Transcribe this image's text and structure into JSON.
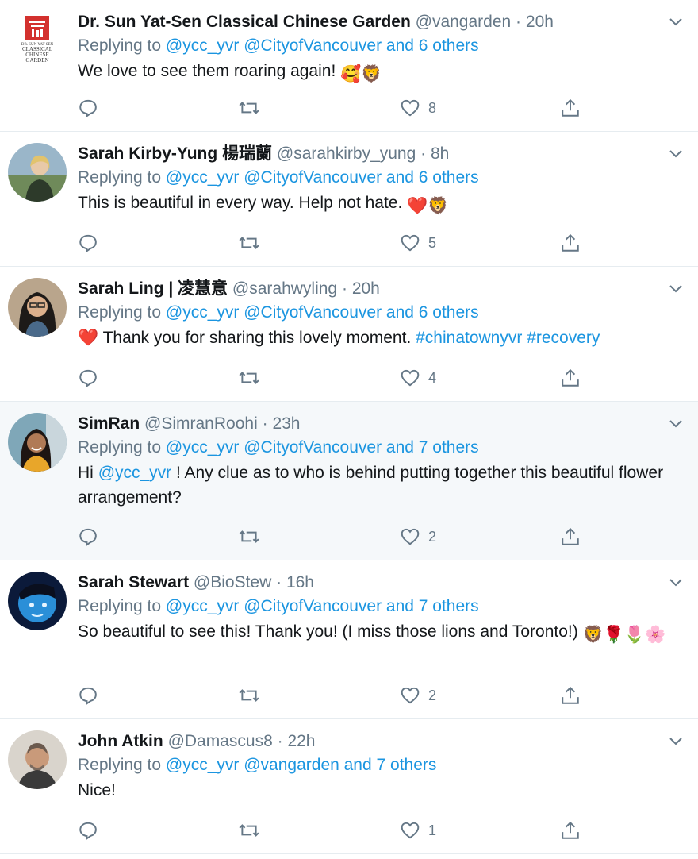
{
  "tweets": [
    {
      "name": "Dr. Sun Yat-Sen Classical Chinese Garden",
      "handle": "@vangarden",
      "time": "20h",
      "reply_prefix": "Replying to",
      "reply_mentions": "@ycc_yvr @CityofVancouver and 6 others",
      "text_before": "We love to see them roaring again!",
      "text_link": "",
      "text_after": "",
      "text_tags": "",
      "emojis": "🥰🦁",
      "likes": "8",
      "avatar_type": "garden-logo"
    },
    {
      "name": "Sarah Kirby-Yung 楊瑞蘭",
      "handle": "@sarahkirby_yung",
      "time": "8h",
      "reply_prefix": "Replying to",
      "reply_mentions": "@ycc_yvr @CityofVancouver and 6 others",
      "text_before": "This is beautiful in every way. Help not hate.",
      "text_link": "",
      "text_after": "",
      "text_tags": "",
      "emojis": "❤️🦁",
      "likes": "5",
      "avatar_type": "photo"
    },
    {
      "name": "Sarah Ling | 凌慧意",
      "handle": "@sarahwyling",
      "time": "20h",
      "reply_prefix": "Replying to",
      "reply_mentions": "@ycc_yvr @CityofVancouver and 6 others",
      "text_before": "❤️ Thank you for sharing this lovely moment.",
      "text_link": "",
      "text_after": "",
      "text_tags": "#chinatownyvr #recovery",
      "emojis": "",
      "likes": "4",
      "avatar_type": "photo"
    },
    {
      "name": "SimRan",
      "handle": "@SimranRoohi",
      "time": "23h",
      "reply_prefix": "Replying to",
      "reply_mentions": "@ycc_yvr @CityofVancouver and 7 others",
      "text_before": "Hi",
      "text_link": "@ycc_yvr",
      "text_after": "! Any clue as to who is behind putting together this beautiful flower arrangement?",
      "text_tags": "",
      "emojis": "",
      "likes": "2",
      "avatar_type": "photo"
    },
    {
      "name": "Sarah Stewart",
      "handle": "@BioStew",
      "time": "16h",
      "reply_prefix": "Replying to",
      "reply_mentions": "@ycc_yvr @CityofVancouver and 7 others",
      "text_before": "So beautiful to see this! Thank you! (I miss those lions and Toronto!)",
      "text_link": "",
      "text_after": "",
      "text_tags": "",
      "emojis": "🦁🌹🌷🌸",
      "likes": "2",
      "avatar_type": "photo"
    },
    {
      "name": "John Atkin",
      "handle": "@Damascus8",
      "time": "22h",
      "reply_prefix": "Replying to",
      "reply_mentions": "@ycc_yvr @vangarden and 7 others",
      "text_before": "Nice!",
      "text_link": "",
      "text_after": "",
      "text_tags": "",
      "emojis": "",
      "likes": "1",
      "avatar_type": "photo"
    }
  ],
  "garden_logo": {
    "line1": "DR. SUN YAT-SEN",
    "line2": "CLASSICAL",
    "line3": "CHINESE",
    "line4": "GARDEN"
  },
  "colors": {
    "link": "#1b95e0",
    "secondary": "#657786",
    "highlight_bg": "#f5f8fa",
    "divider": "#e6ecf0"
  }
}
